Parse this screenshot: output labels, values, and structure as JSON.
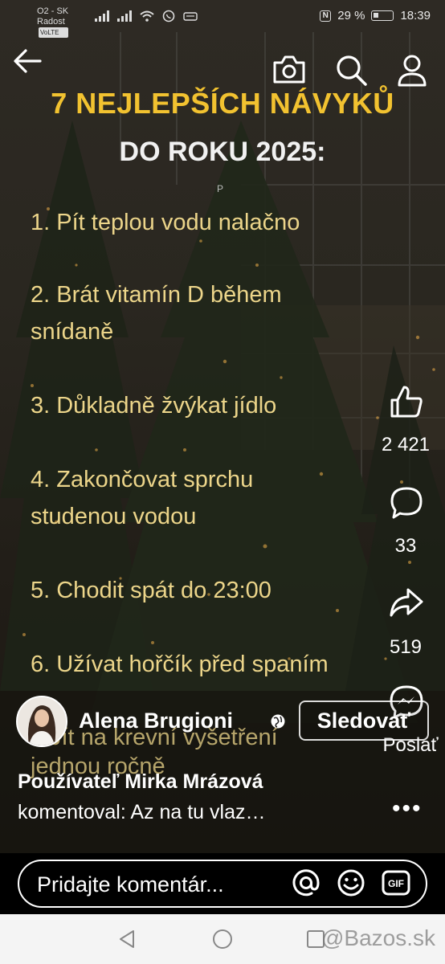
{
  "status_bar": {
    "carrier_line1": "O2 - SK",
    "carrier_line2": "Radost",
    "volte": "VoLTE",
    "battery_percent": "29 %",
    "battery_level": 0.29,
    "time": "18:39"
  },
  "post": {
    "title_line1": "7 NEJLEPŠÍCH NÁVYKŮ",
    "title_line2": "DO ROKU 2025:",
    "stray_letter": "P",
    "items": [
      "1. Pít teplou vodu nalačno",
      "2. Brát vitamín D během snídaně",
      "3. Důkladně žvýkat jídlo",
      "4. Zakončovat sprchu studenou vodou",
      "5. Chodit spát do 23:00",
      "6. Užívat hořčík před spaním"
    ],
    "item7_partial_line1": "Jít na krevní vyšetření",
    "item7_partial_line2": "jednou ročně"
  },
  "rail": {
    "likes": "2 421",
    "comments": "33",
    "shares": "519",
    "send_label": "Poslať"
  },
  "author": {
    "name": "Alena Brugioni",
    "follow_label": "Sledovať"
  },
  "comment_preview": {
    "author": "Používateľ Mirka Mrázová",
    "text": "komentoval: Az na tu vlaz…"
  },
  "comment_bar": {
    "placeholder": "Pridajte komentár..."
  },
  "watermark": "@Bazos.sk",
  "colors": {
    "title_yellow": "#f2c230",
    "item_text": "#ecd58a"
  },
  "icons": [
    "back-arrow-icon",
    "camera-icon",
    "search-icon",
    "profile-icon",
    "like-icon",
    "comment-icon",
    "share-icon",
    "messenger-icon",
    "more-icon",
    "globe-icon",
    "mention-icon",
    "emoji-icon",
    "gif-icon",
    "nav-back-icon",
    "nav-home-icon"
  ]
}
